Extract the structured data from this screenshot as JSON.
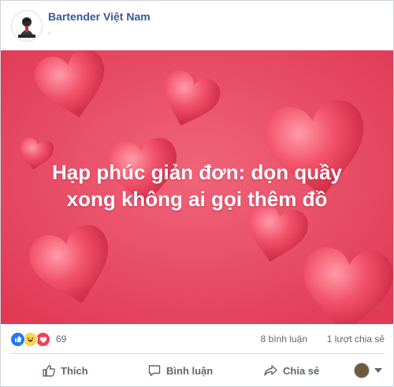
{
  "post": {
    "page_name": "Bartender Việt Nam",
    "meta_dot": ".",
    "image": {
      "headline_line1": "Hạp phúc giản đơn: dọn quầy",
      "headline_line2": "xong không ai gọi thêm đồ"
    }
  },
  "reactions": {
    "icons": [
      "like-icon",
      "haha-icon",
      "love-icon"
    ],
    "count": "69",
    "comments": "8 bình luận",
    "shares": "1 lượt chia sẻ"
  },
  "actions": {
    "like_label": "Thích",
    "comment_label": "Bình luận",
    "share_label": "Chia sẻ"
  },
  "colors": {
    "brand_link": "#365899",
    "background_pink": "#e8485f",
    "like_blue": "#2078f4",
    "love_red": "#f33e58",
    "haha_yellow": "#fcd34d"
  }
}
